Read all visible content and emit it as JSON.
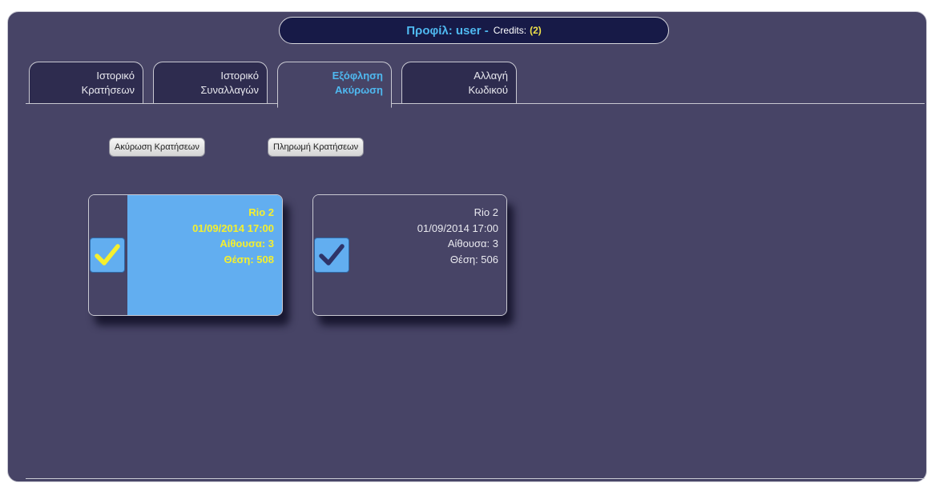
{
  "header": {
    "profile_text": "Προφίλ: user -",
    "credits_label": "Credits:",
    "credits_value": "(2)"
  },
  "tabs": [
    {
      "line1": "Ιστορικό",
      "line2": "Κρατήσεων",
      "active": false
    },
    {
      "line1": "Ιστορικό",
      "line2": "Συναλλαγών",
      "active": false
    },
    {
      "line1": "Εξόφληση",
      "line2": "Ακύρωση",
      "active": true
    },
    {
      "line1": "Αλλαγή",
      "line2": "Κωδικού",
      "active": false
    }
  ],
  "actions": {
    "cancel_label": "Ακύρωση Κρατήσεων",
    "pay_label": "Πληρωμή Κρατήσεων"
  },
  "bookings": [
    {
      "movie": "Rio 2",
      "datetime": "01/09/2014 17:00",
      "hall": "Αίθουσα: 3",
      "seat": "Θέση: 508",
      "selected": true,
      "check_color": "#f5ef2e"
    },
    {
      "movie": "Rio 2",
      "datetime": "01/09/2014 17:00",
      "hall": "Αίθουσα: 3",
      "seat": "Θέση: 506",
      "selected": false,
      "check_color": "#2e3468"
    }
  ],
  "colors": {
    "background": "#474466",
    "header_bg": "#171a47",
    "accent_blue": "#4fb9f0",
    "credits_yellow": "#f0e24a",
    "selected_card": "#62aef0",
    "selected_text": "#f5ef2e"
  },
  "icons": {
    "checkbox": "checkmark-icon"
  }
}
